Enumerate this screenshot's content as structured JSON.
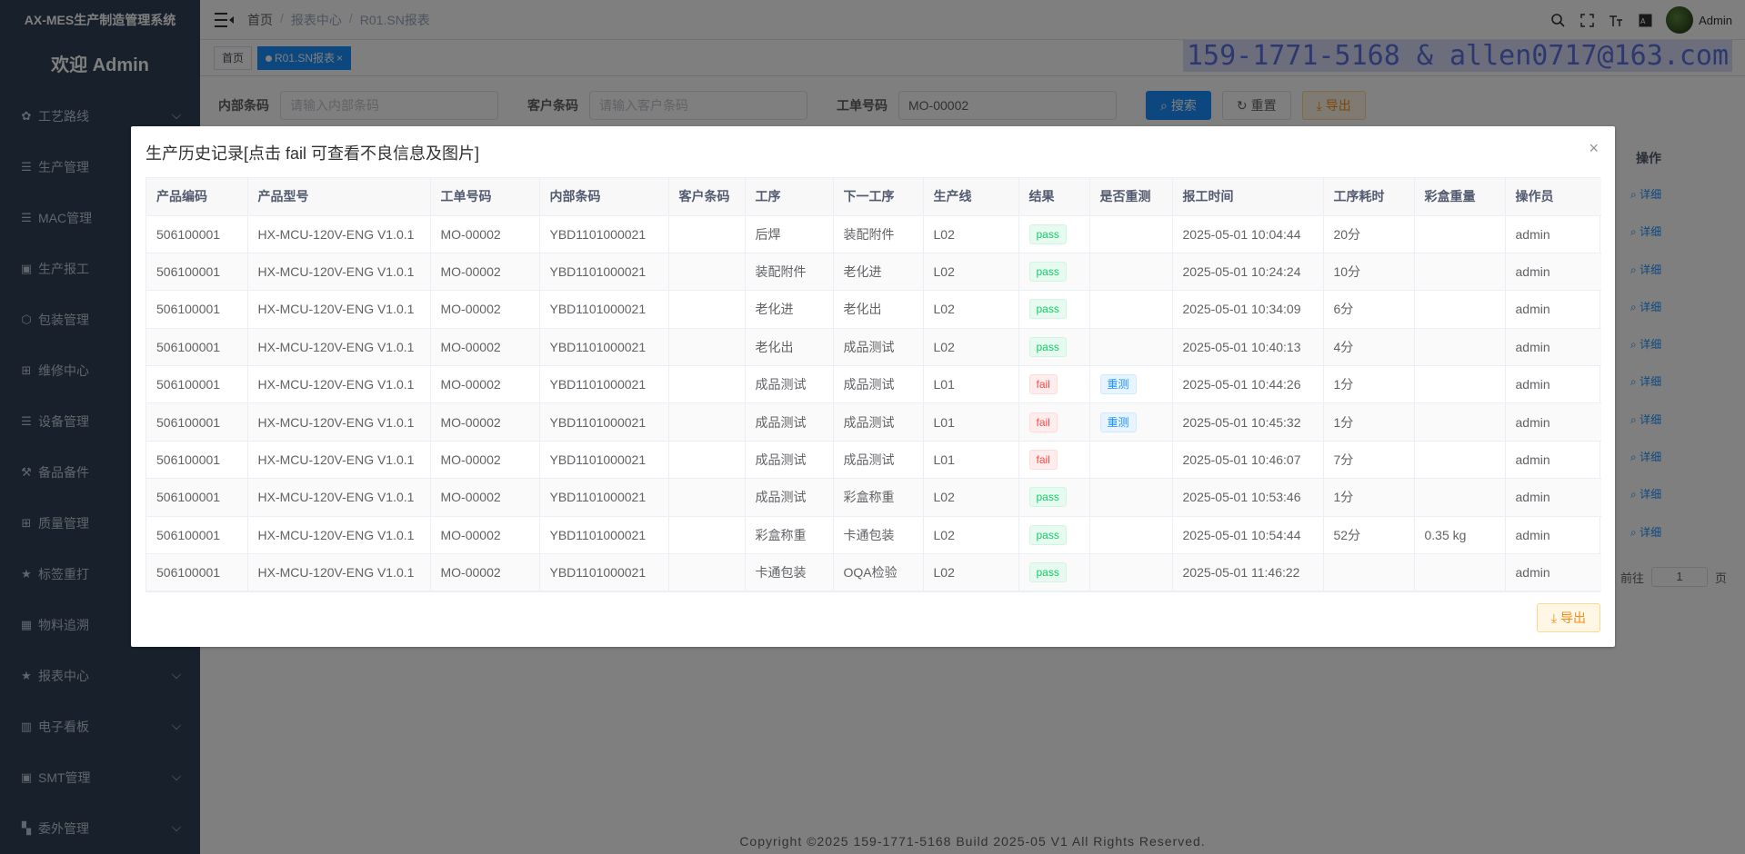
{
  "sidebar": {
    "system_title": "AX-MES生产制造管理系统",
    "welcome": "欢迎 Admin",
    "items": [
      {
        "label": "工艺路线",
        "icon": "gear-icon",
        "glyph": "✿",
        "arrow": true
      },
      {
        "label": "生产管理",
        "icon": "list-icon",
        "glyph": "☰",
        "arrow": false
      },
      {
        "label": "MAC管理",
        "icon": "list-icon",
        "glyph": "☰",
        "arrow": false
      },
      {
        "label": "生产报工",
        "icon": "monitor-icon",
        "glyph": "▣",
        "arrow": false
      },
      {
        "label": "包装管理",
        "icon": "box-icon",
        "glyph": "⬡",
        "arrow": false
      },
      {
        "label": "维修中心",
        "icon": "grid-icon",
        "glyph": "⊞",
        "arrow": false
      },
      {
        "label": "设备管理",
        "icon": "list-icon",
        "glyph": "☰",
        "arrow": false
      },
      {
        "label": "备品备件",
        "icon": "wrench-icon",
        "glyph": "⚒",
        "arrow": false
      },
      {
        "label": "质量管理",
        "icon": "grid-icon",
        "glyph": "⊞",
        "arrow": false
      },
      {
        "label": "标签重打",
        "icon": "star-icon",
        "glyph": "★",
        "arrow": false
      },
      {
        "label": "物料追溯",
        "icon": "table-icon",
        "glyph": "▦",
        "arrow": false
      },
      {
        "label": "报表中心",
        "icon": "star-icon",
        "glyph": "★",
        "arrow": true
      },
      {
        "label": "电子看板",
        "icon": "bar-chart-icon",
        "glyph": "▥",
        "arrow": true
      },
      {
        "label": "SMT管理",
        "icon": "monitor-icon",
        "glyph": "▣",
        "arrow": true
      },
      {
        "label": "委外管理",
        "icon": "apps-icon",
        "glyph": "▚",
        "arrow": true
      }
    ]
  },
  "header": {
    "breadcrumb": [
      "首页",
      "报表中心",
      "R01.SN报表"
    ],
    "user": "Admin"
  },
  "tags": {
    "home": "首页",
    "active": "R01.SN报表",
    "close": "×"
  },
  "watermark": "159-1771-5168 & allen0717@163.com",
  "search": {
    "internal_label": "内部条码",
    "internal_placeholder": "请输入内部条码",
    "customer_label": "客户条码",
    "customer_placeholder": "请输入客户条码",
    "order_label": "工单号码",
    "order_value": "MO-00002",
    "search_btn": "搜索",
    "reset_btn": "重置",
    "export_btn": "导出"
  },
  "background_table": {
    "ops_header": "操作",
    "ops_label": "详细",
    "pager_goto": "前往",
    "pager_page": "1",
    "pager_unit": "页"
  },
  "footer": "Copyright ©2025 159-1771-5168 Build 2025-05 V1 All Rights Reserved.",
  "dialog": {
    "title": "生产历史记录[点击 fail 可查看不良信息及图片]",
    "close": "×",
    "export_btn": "导出",
    "columns": [
      "产品编码",
      "产品型号",
      "工单号码",
      "内部条码",
      "客户条码",
      "工序",
      "下一工序",
      "生产线",
      "结果",
      "是否重测",
      "报工时间",
      "工序耗时",
      "彩盒重量",
      "操作员"
    ],
    "rows": [
      [
        "506100001",
        "HX-MCU-120V-ENG V1.0.1",
        "MO-00002",
        "YBD1101000021",
        "",
        "后焊",
        "装配附件",
        "L02",
        "pass",
        "",
        "2025-05-01 10:04:44",
        "20分",
        "",
        "admin"
      ],
      [
        "506100001",
        "HX-MCU-120V-ENG V1.0.1",
        "MO-00002",
        "YBD1101000021",
        "",
        "装配附件",
        "老化进",
        "L02",
        "pass",
        "",
        "2025-05-01 10:24:24",
        "10分",
        "",
        "admin"
      ],
      [
        "506100001",
        "HX-MCU-120V-ENG V1.0.1",
        "MO-00002",
        "YBD1101000021",
        "",
        "老化进",
        "老化出",
        "L02",
        "pass",
        "",
        "2025-05-01 10:34:09",
        "6分",
        "",
        "admin"
      ],
      [
        "506100001",
        "HX-MCU-120V-ENG V1.0.1",
        "MO-00002",
        "YBD1101000021",
        "",
        "老化出",
        "成品测试",
        "L02",
        "pass",
        "",
        "2025-05-01 10:40:13",
        "4分",
        "",
        "admin"
      ],
      [
        "506100001",
        "HX-MCU-120V-ENG V1.0.1",
        "MO-00002",
        "YBD1101000021",
        "",
        "成品测试",
        "成品测试",
        "L01",
        "fail",
        "重测",
        "2025-05-01 10:44:26",
        "1分",
        "",
        "admin"
      ],
      [
        "506100001",
        "HX-MCU-120V-ENG V1.0.1",
        "MO-00002",
        "YBD1101000021",
        "",
        "成品测试",
        "成品测试",
        "L01",
        "fail",
        "重测",
        "2025-05-01 10:45:32",
        "1分",
        "",
        "admin"
      ],
      [
        "506100001",
        "HX-MCU-120V-ENG V1.0.1",
        "MO-00002",
        "YBD1101000021",
        "",
        "成品测试",
        "成品测试",
        "L01",
        "fail",
        "",
        "2025-05-01 10:46:07",
        "7分",
        "",
        "admin"
      ],
      [
        "506100001",
        "HX-MCU-120V-ENG V1.0.1",
        "MO-00002",
        "YBD1101000021",
        "",
        "成品测试",
        "彩盒称重",
        "L02",
        "pass",
        "",
        "2025-05-01 10:53:46",
        "1分",
        "",
        "admin"
      ],
      [
        "506100001",
        "HX-MCU-120V-ENG V1.0.1",
        "MO-00002",
        "YBD1101000021",
        "",
        "彩盒称重",
        "卡通包装",
        "L02",
        "pass",
        "",
        "2025-05-01 10:54:44",
        "52分",
        "0.35 kg",
        "admin"
      ],
      [
        "506100001",
        "HX-MCU-120V-ENG V1.0.1",
        "MO-00002",
        "YBD1101000021",
        "",
        "卡通包装",
        "OQA检验",
        "L02",
        "pass",
        "",
        "2025-05-01 11:46:22",
        "",
        "",
        "admin"
      ]
    ]
  },
  "colors": {
    "sidebar_bg": "#304156",
    "primary": "#1890ff",
    "pass": "#13ce66",
    "fail": "#ff4949",
    "warning": "#fa8c16"
  }
}
